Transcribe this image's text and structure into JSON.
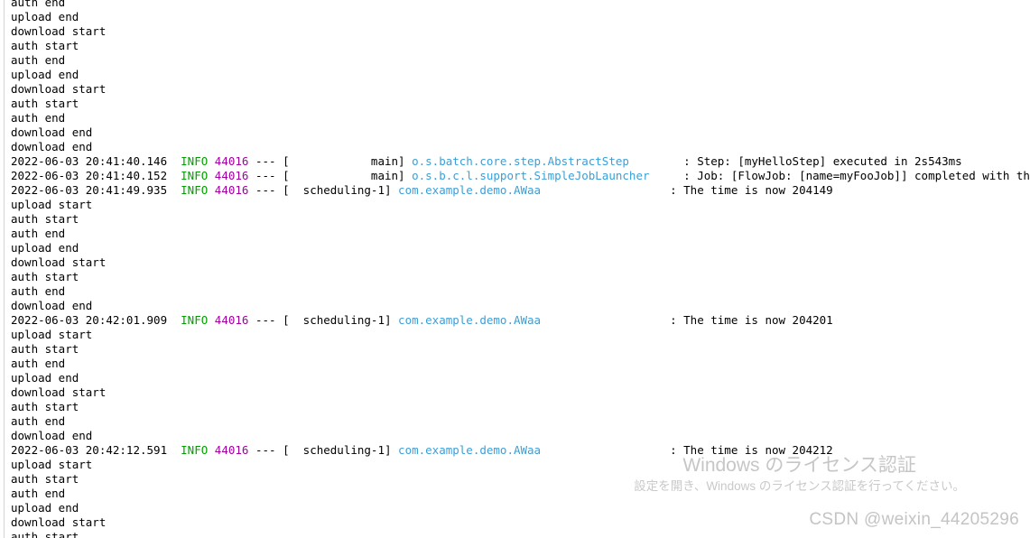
{
  "console": {
    "background_color": "#ffffff",
    "text_color": "#000000",
    "colors": {
      "level_info": "#00a000",
      "pid": "#a000a0",
      "logger": "#3a9fd8",
      "gutter": "#d4d4d4",
      "watermark": "#c6c6c6"
    },
    "lines": [
      {
        "type": "plain",
        "text": "auth end"
      },
      {
        "type": "plain",
        "text": "upload end"
      },
      {
        "type": "plain",
        "text": "download start"
      },
      {
        "type": "plain",
        "text": "auth start"
      },
      {
        "type": "plain",
        "text": "auth end"
      },
      {
        "type": "plain",
        "text": "upload end"
      },
      {
        "type": "plain",
        "text": "download start"
      },
      {
        "type": "plain",
        "text": "auth start"
      },
      {
        "type": "plain",
        "text": "auth end"
      },
      {
        "type": "plain",
        "text": "download end"
      },
      {
        "type": "plain",
        "text": "download end"
      },
      {
        "type": "log",
        "timestamp": "2022-06-03 20:41:40.146",
        "level": "INFO",
        "pid": "44016",
        "dashes": "---",
        "thread": "main",
        "thread_pad": "            ",
        "logger": "o.s.batch.core.step.AbstractStep",
        "message": ": Step: [myHelloStep] executed in 2s543ms"
      },
      {
        "type": "log",
        "timestamp": "2022-06-03 20:41:40.152",
        "level": "INFO",
        "pid": "44016",
        "dashes": "---",
        "thread": "main",
        "thread_pad": "            ",
        "logger": "o.s.b.c.l.support.SimpleJobLauncher",
        "message": ": Job: [FlowJob: [name=myFooJob]] completed with the following"
      },
      {
        "type": "log",
        "timestamp": "2022-06-03 20:41:49.935",
        "level": "INFO",
        "pid": "44016",
        "dashes": "---",
        "thread": "scheduling-1",
        "thread_pad": "  ",
        "logger": "com.example.demo.AWaa",
        "message": ": The time is now 204149"
      },
      {
        "type": "plain",
        "text": "upload start"
      },
      {
        "type": "plain",
        "text": "auth start"
      },
      {
        "type": "plain",
        "text": "auth end"
      },
      {
        "type": "plain",
        "text": "upload end"
      },
      {
        "type": "plain",
        "text": "download start"
      },
      {
        "type": "plain",
        "text": "auth start"
      },
      {
        "type": "plain",
        "text": "auth end"
      },
      {
        "type": "plain",
        "text": "download end"
      },
      {
        "type": "log",
        "timestamp": "2022-06-03 20:42:01.909",
        "level": "INFO",
        "pid": "44016",
        "dashes": "---",
        "thread": "scheduling-1",
        "thread_pad": "  ",
        "logger": "com.example.demo.AWaa",
        "message": ": The time is now 204201"
      },
      {
        "type": "plain",
        "text": "upload start"
      },
      {
        "type": "plain",
        "text": "auth start"
      },
      {
        "type": "plain",
        "text": "auth end"
      },
      {
        "type": "plain",
        "text": "upload end"
      },
      {
        "type": "plain",
        "text": "download start"
      },
      {
        "type": "plain",
        "text": "auth start"
      },
      {
        "type": "plain",
        "text": "auth end"
      },
      {
        "type": "plain",
        "text": "download end"
      },
      {
        "type": "log",
        "timestamp": "2022-06-03 20:42:12.591",
        "level": "INFO",
        "pid": "44016",
        "dashes": "---",
        "thread": "scheduling-1",
        "thread_pad": "  ",
        "logger": "com.example.demo.AWaa",
        "message": ": The time is now 204212"
      },
      {
        "type": "plain",
        "text": "upload start"
      },
      {
        "type": "plain",
        "text": "auth start"
      },
      {
        "type": "plain",
        "text": "auth end"
      },
      {
        "type": "plain",
        "text": "upload end"
      },
      {
        "type": "plain",
        "text": "download start"
      },
      {
        "type": "plain",
        "text": "auth start"
      }
    ]
  },
  "watermarks": {
    "windows_activation_title": "Windows のライセンス認証",
    "windows_activation_subtitle": "設定を開き、Windows のライセンス認証を行ってください。",
    "csdn_author": "CSDN @weixin_44205296"
  }
}
